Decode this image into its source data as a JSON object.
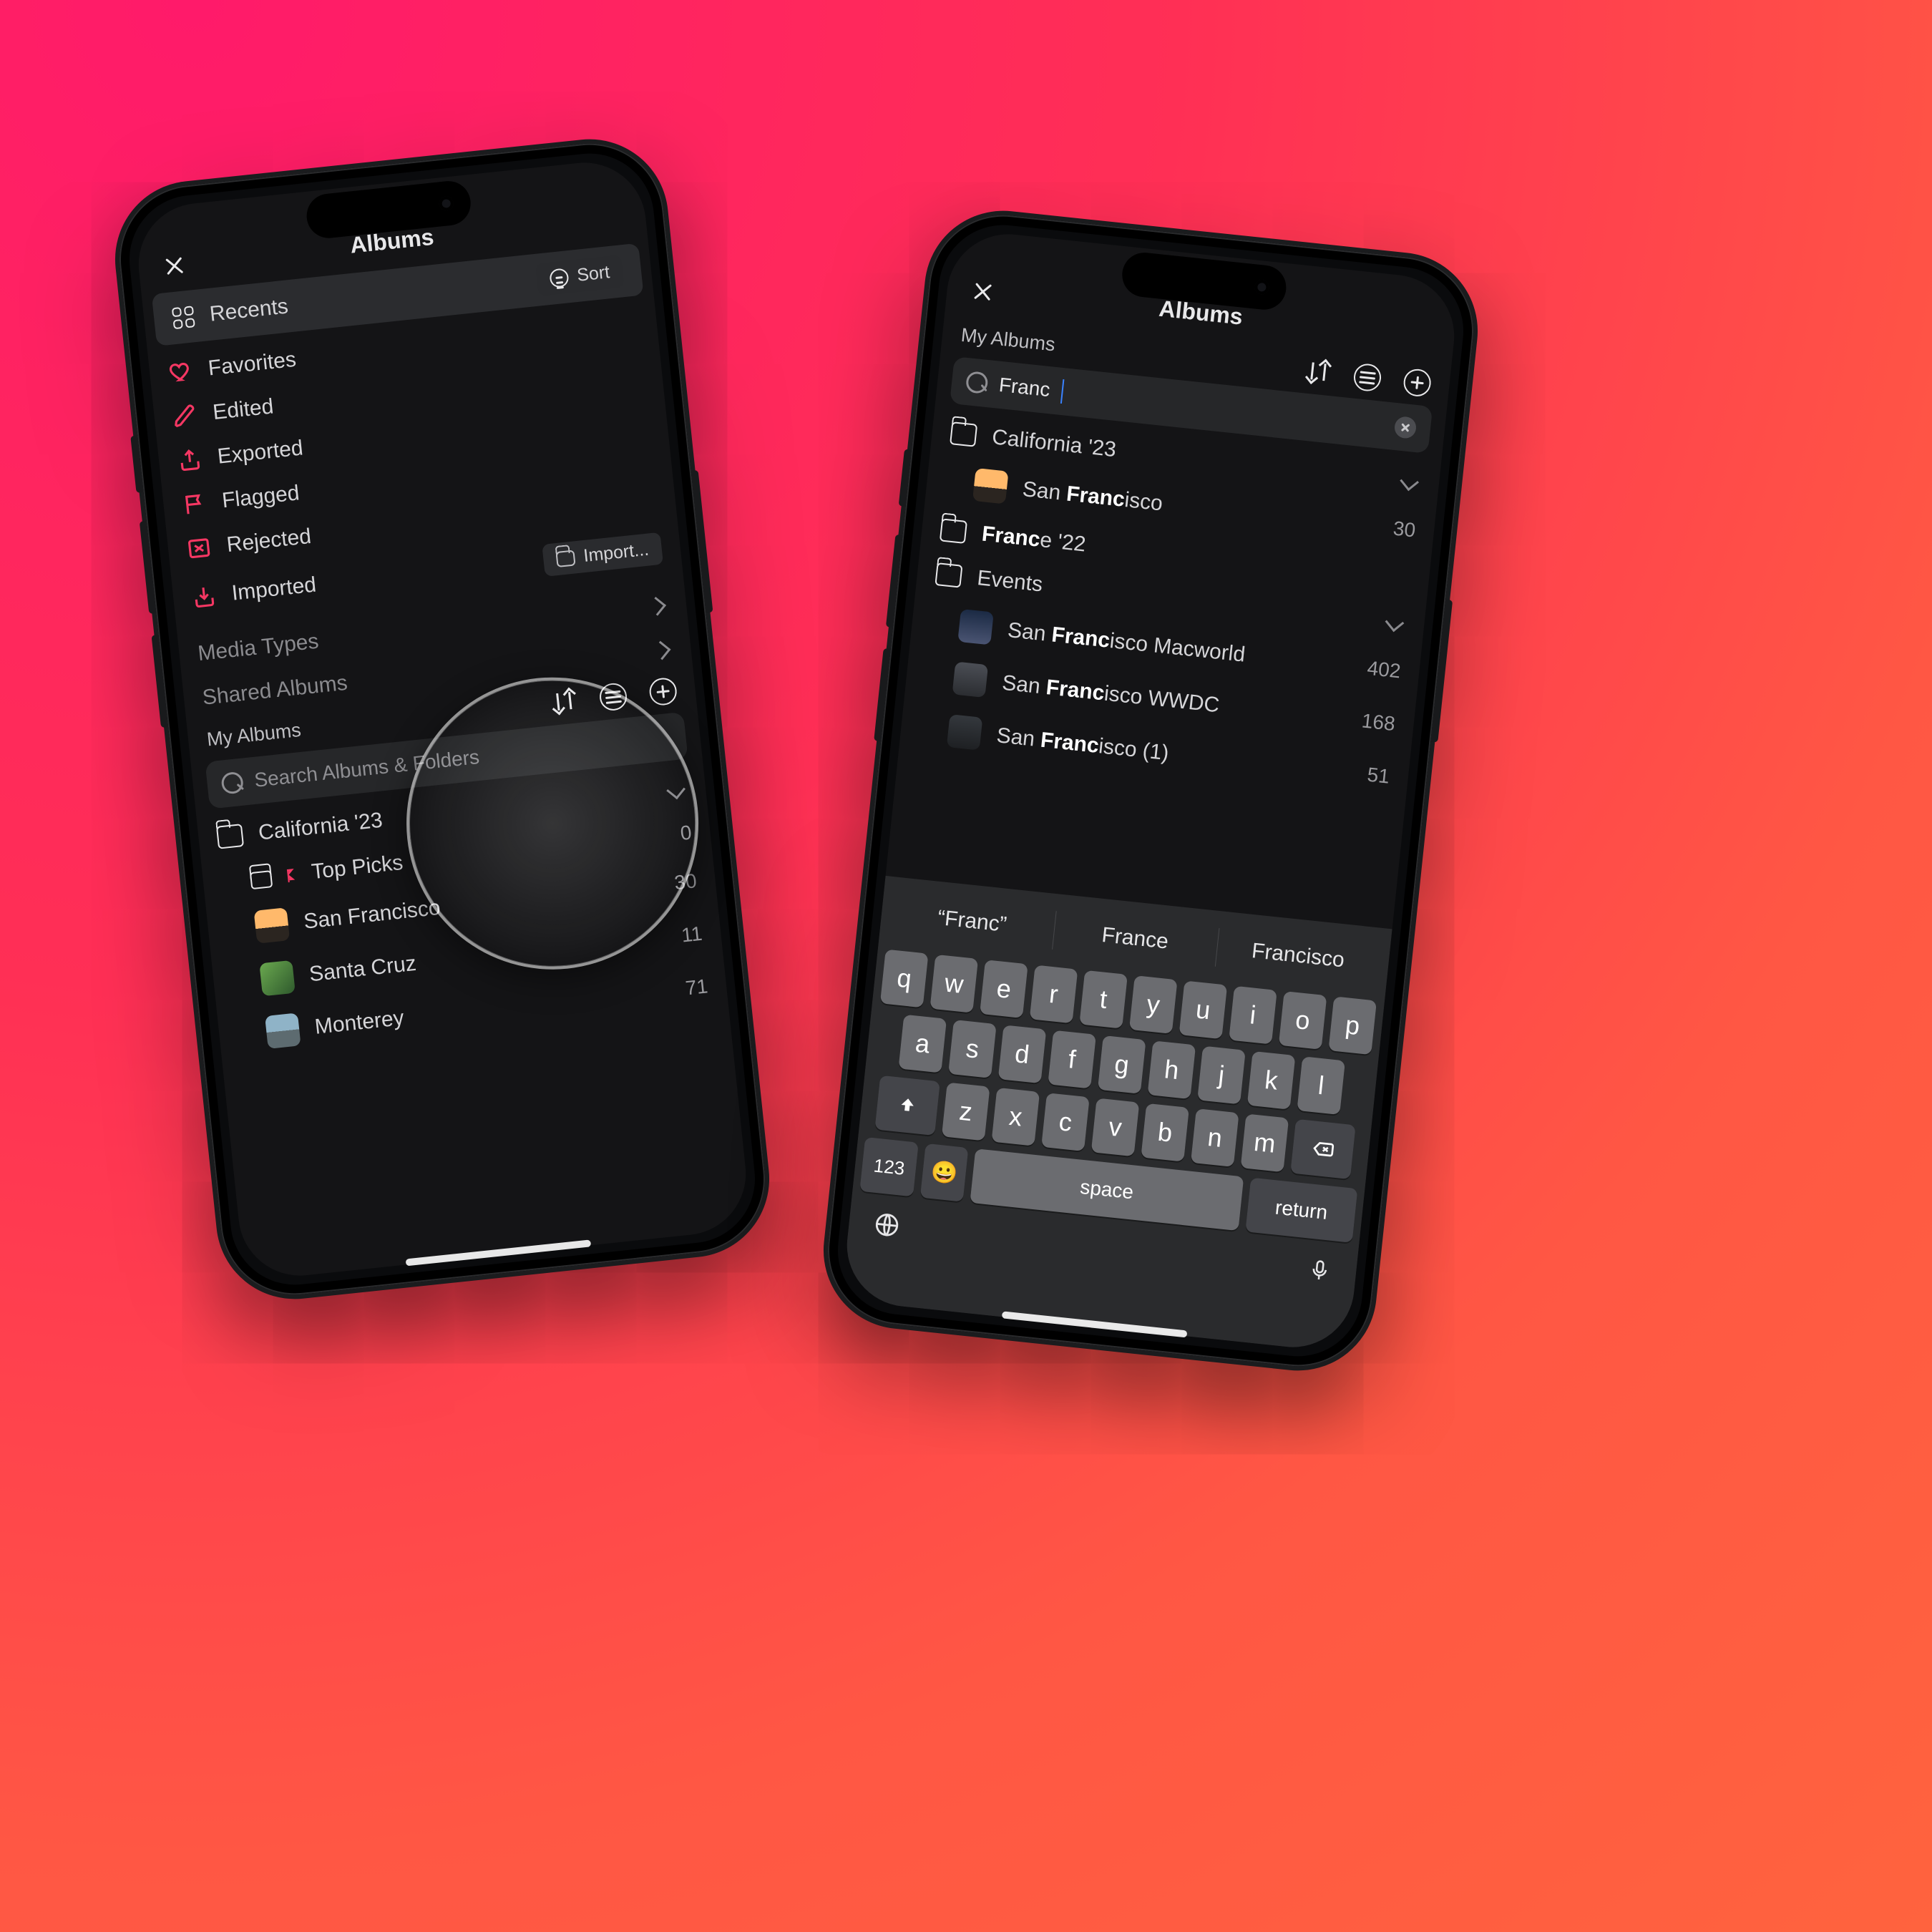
{
  "left": {
    "title": "Albums",
    "smart": {
      "recents": "Recents",
      "sort": "Sort",
      "favorites": "Favorites",
      "edited": "Edited",
      "exported": "Exported",
      "flagged": "Flagged",
      "rejected": "Rejected",
      "imported": "Imported",
      "import_btn": "Import..."
    },
    "sections": {
      "media_types": "Media Types",
      "shared": "Shared Albums",
      "my_albums": "My Albums"
    },
    "search_placeholder": "Search Albums & Folders",
    "folder": {
      "name": "California '23",
      "albums": [
        {
          "name": "Top Picks",
          "count": "0"
        },
        {
          "name": "San Francisco",
          "count": "30"
        },
        {
          "name": "Santa Cruz",
          "count": "11"
        },
        {
          "name": "Monterey",
          "count": "71"
        }
      ]
    }
  },
  "right": {
    "title": "Albums",
    "section": "My Albums",
    "search_value": "Franc",
    "groups": [
      {
        "name": "California '23"
      },
      {
        "name": "France '22",
        "name_pre": "Franc",
        "name_rest": "e '22"
      },
      {
        "name": "Events"
      }
    ],
    "results": [
      {
        "pre": "San ",
        "bold": "Franc",
        "post": "isco",
        "count": "30"
      },
      {
        "pre": "San ",
        "bold": "Franc",
        "post": "isco Macworld",
        "count": "402"
      },
      {
        "pre": "San ",
        "bold": "Franc",
        "post": "isco WWDC",
        "count": "168"
      },
      {
        "pre": "San ",
        "bold": "Franc",
        "post": "isco (1)",
        "count": "51"
      }
    ],
    "suggestions": [
      "“Franc”",
      "France",
      "Francisco"
    ],
    "keys": {
      "row1": [
        "q",
        "w",
        "e",
        "r",
        "t",
        "y",
        "u",
        "i",
        "o",
        "p"
      ],
      "row2": [
        "a",
        "s",
        "d",
        "f",
        "g",
        "h",
        "j",
        "k",
        "l"
      ],
      "row3": [
        "z",
        "x",
        "c",
        "v",
        "b",
        "n",
        "m"
      ],
      "space": "space",
      "ret": "return",
      "num": "123"
    }
  }
}
